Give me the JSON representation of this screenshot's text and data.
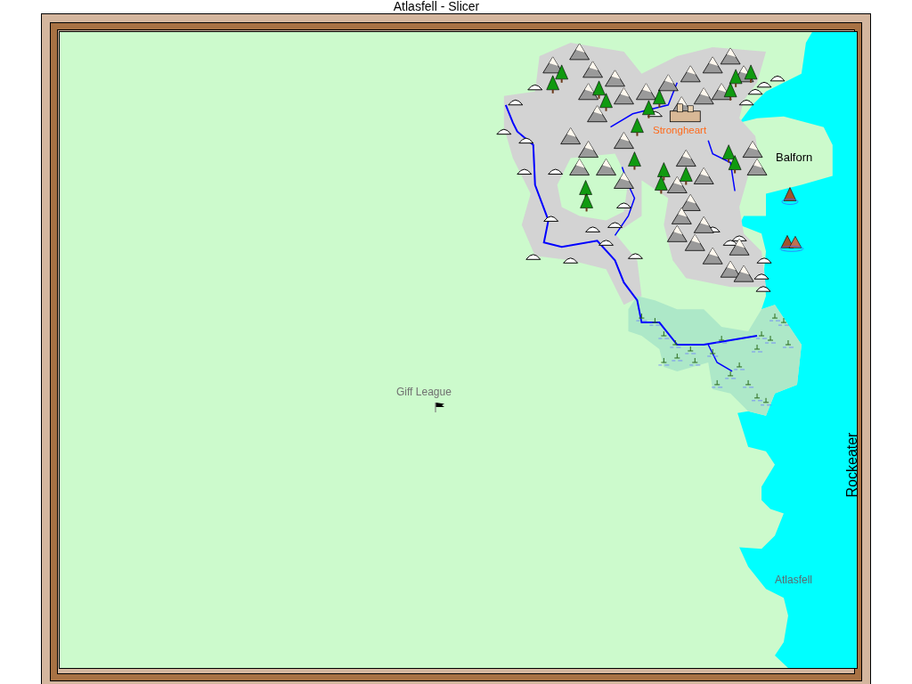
{
  "window": {
    "title": "Atlasfell - Slicer"
  },
  "map": {
    "city": "Strongheart",
    "region": "Balforn",
    "sea": "Rockeater",
    "realm": "Atlasfell",
    "faction": "Giff League"
  }
}
